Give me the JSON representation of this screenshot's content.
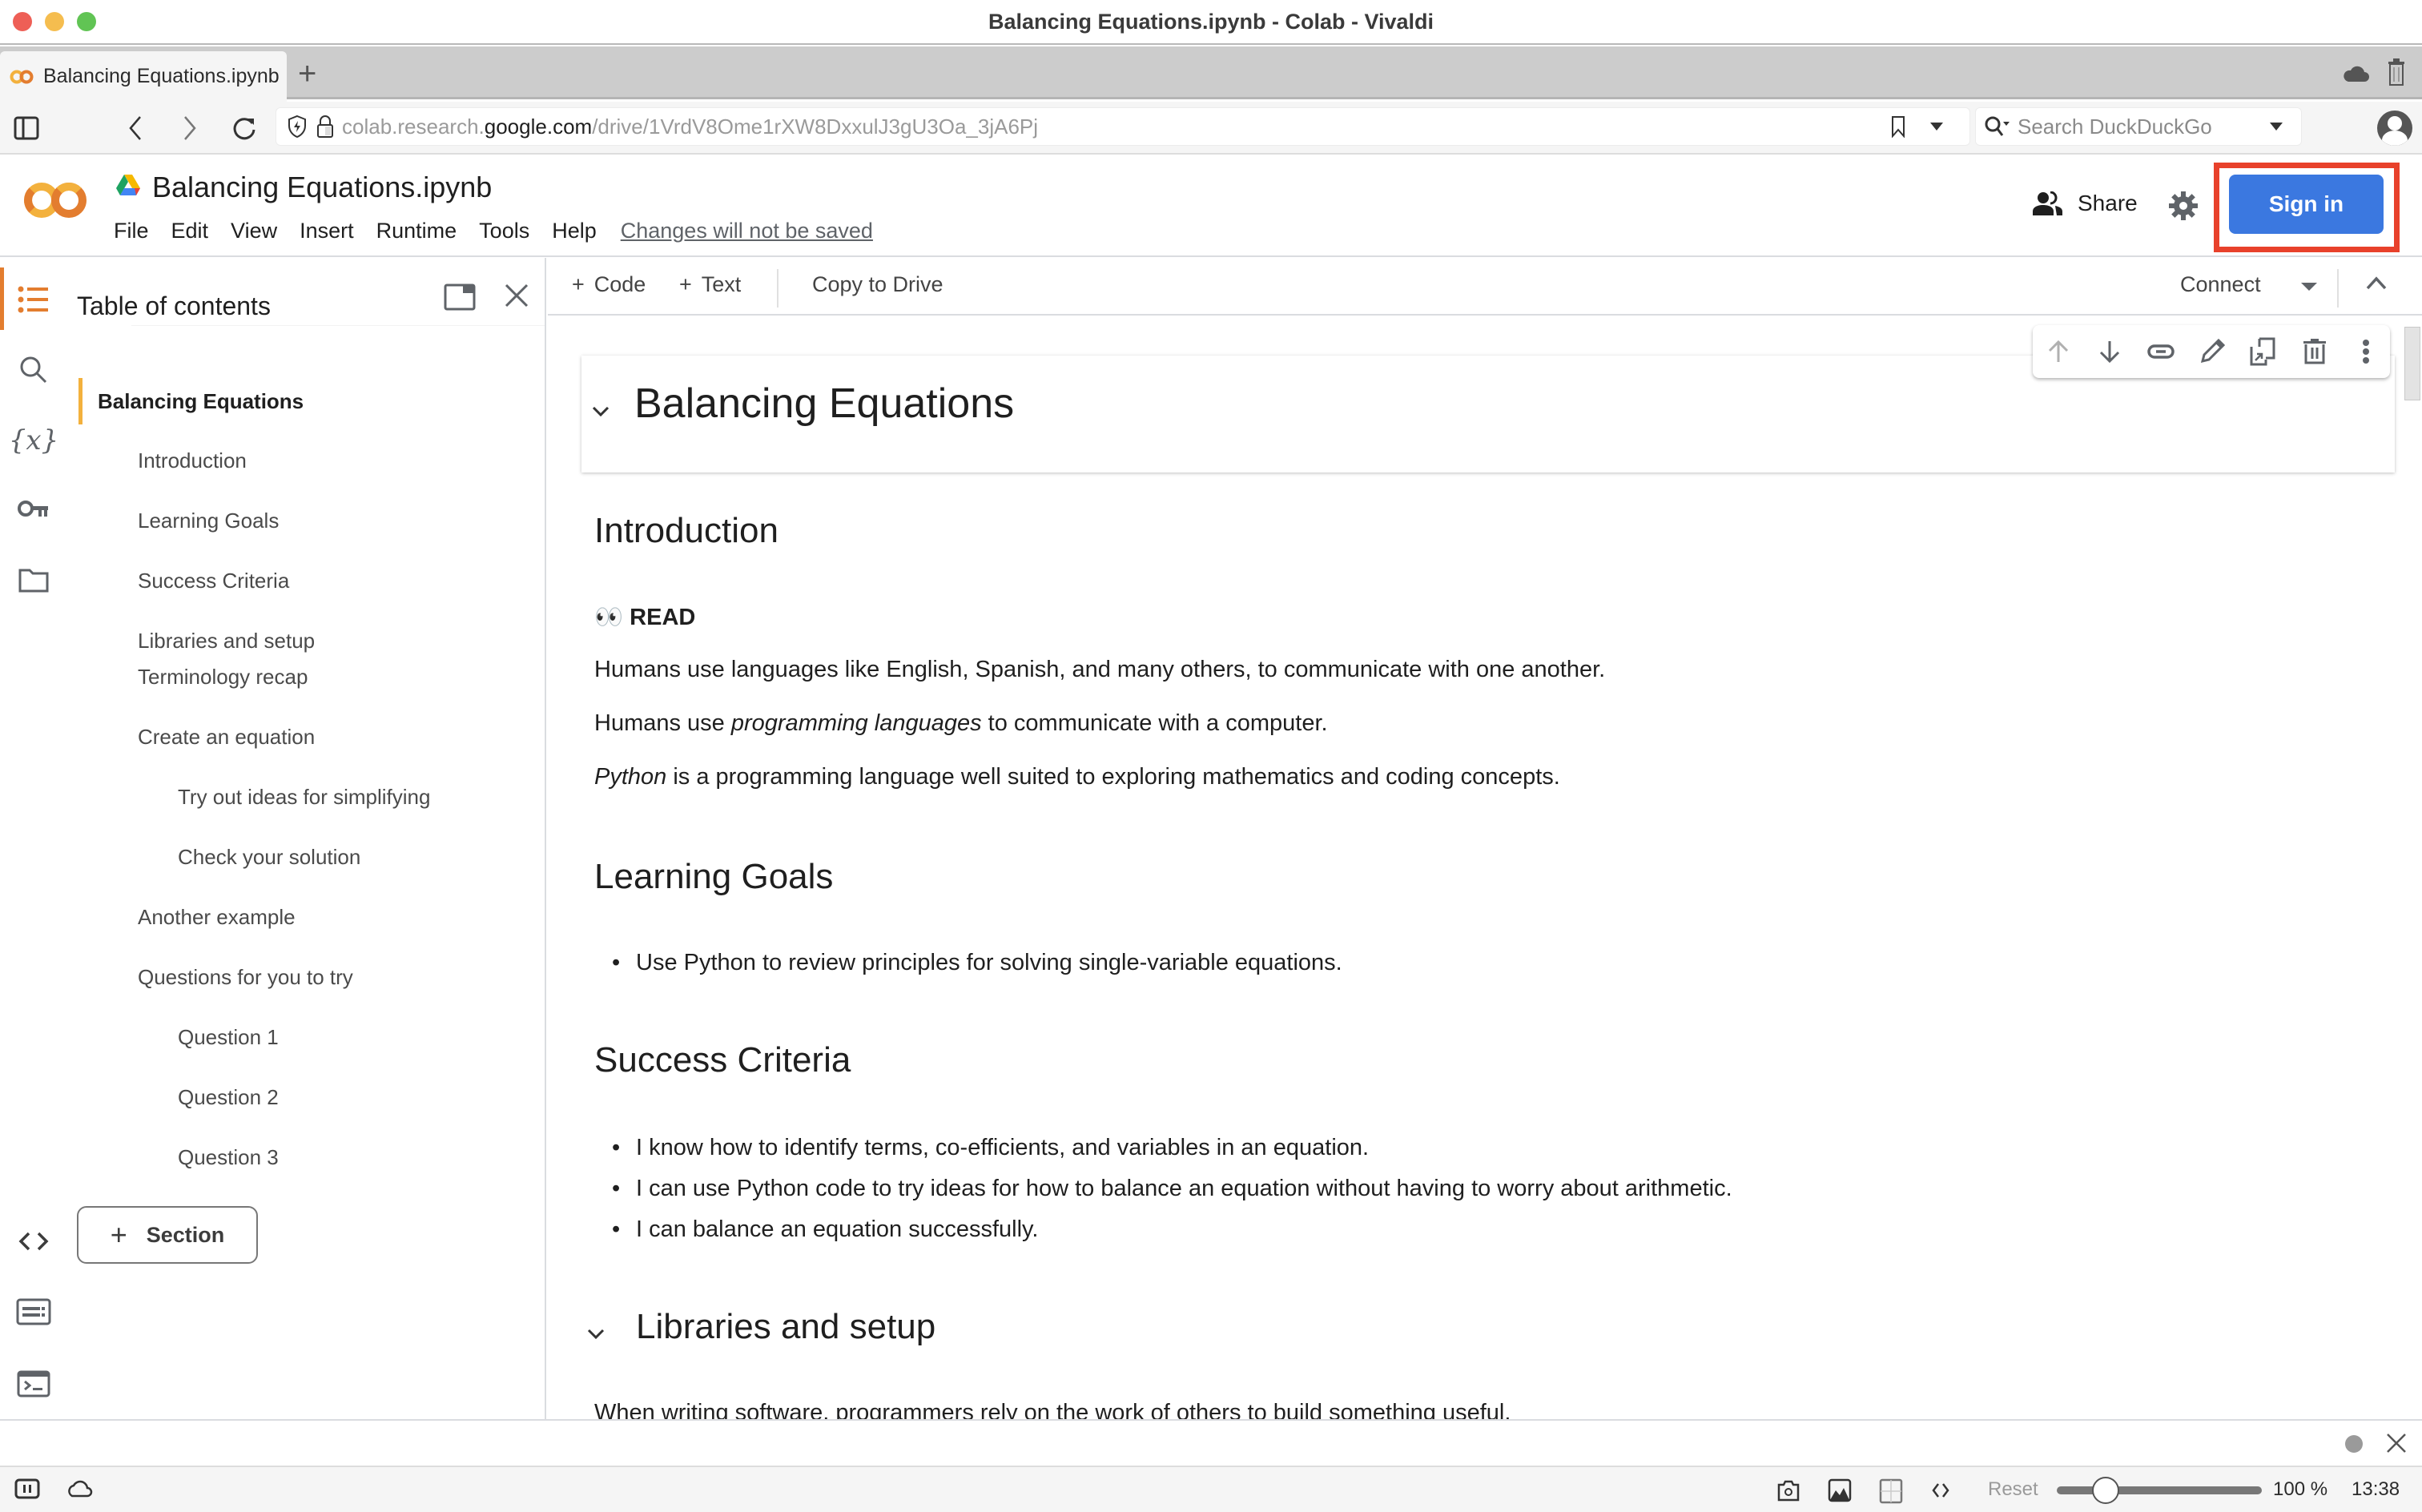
{
  "window": {
    "title": "Balancing Equations.ipynb - Colab - Vivaldi"
  },
  "browser": {
    "tabs": [
      {
        "label": "Balancing Equations.ipynb",
        "active": true
      }
    ],
    "new_tab_label": "+",
    "address": {
      "prefix": "colab.research.",
      "domain": "google.com",
      "path": "/drive/1VrdV8Ome1rXW8DxxulJ3gU3Oa_3jA6Pj"
    },
    "search_placeholder": "Search DuckDuckGo"
  },
  "colab": {
    "notebook_title": "Balancing Equations.ipynb",
    "menu": [
      "File",
      "Edit",
      "View",
      "Insert",
      "Runtime",
      "Tools",
      "Help"
    ],
    "unsaved_notice": "Changes will not be saved",
    "share_label": "Share",
    "signin_label": "Sign in",
    "colors": {
      "signin_bg": "#3b78e0",
      "highlight_box": "#e8412b",
      "logo_orange": "#e37d2f",
      "logo_yellow": "#f3b13d",
      "toc_active": "#f3b13d"
    }
  },
  "toolbar": {
    "add_code": "Code",
    "add_text": "Text",
    "copy_to_drive": "Copy to Drive",
    "connect": "Connect"
  },
  "toc": {
    "title": "Table of contents",
    "items": [
      {
        "label": "Balancing Equations",
        "level": 1,
        "active": true
      },
      {
        "label": "Introduction",
        "level": 2
      },
      {
        "label": "Learning Goals",
        "level": 2
      },
      {
        "label": "Success Criteria",
        "level": 2
      },
      {
        "label": "Libraries and setup",
        "level": 2
      },
      {
        "label": "Terminology recap",
        "level": 2
      },
      {
        "label": "Create an equation",
        "level": 2
      },
      {
        "label": "Try out ideas for simplifying",
        "level": 3
      },
      {
        "label": "Check your solution",
        "level": 3
      },
      {
        "label": "Another example",
        "level": 2
      },
      {
        "label": "Questions for you to try",
        "level": 2
      },
      {
        "label": "Question 1",
        "level": 3
      },
      {
        "label": "Question 2",
        "level": 3
      },
      {
        "label": "Question 3",
        "level": 3
      }
    ],
    "add_section_label": "Section"
  },
  "notebook": {
    "title_heading": "Balancing Equations",
    "introduction": {
      "heading": "Introduction",
      "read_label": "READ",
      "read_emoji": "👀",
      "para1": "Humans use languages like English, Spanish, and many others, to communicate with one another.",
      "para2_pre": "Humans use ",
      "para2_em": "programming languages",
      "para2_post": " to communicate with a computer.",
      "para3_em": "Python",
      "para3_post": " is a programming language well suited to exploring mathematics and coding concepts."
    },
    "learning_goals": {
      "heading": "Learning Goals",
      "items": [
        "Use Python to review principles for solving single-variable equations."
      ]
    },
    "success_criteria": {
      "heading": "Success Criteria",
      "items": [
        "I know how to identify terms, co-efficients, and variables in an equation.",
        "I can use Python code to try ideas for how to balance an equation without having to worry about arithmetic.",
        "I can balance an equation successfully."
      ]
    },
    "libraries": {
      "heading": "Libraries and setup",
      "para": "When writing software, programmers rely on the work of others to build something useful."
    }
  },
  "statusbar": {
    "zoom_reset": "Reset",
    "zoom_level": "100 %",
    "zoom_fraction": 0.2,
    "clock": "13:38"
  }
}
